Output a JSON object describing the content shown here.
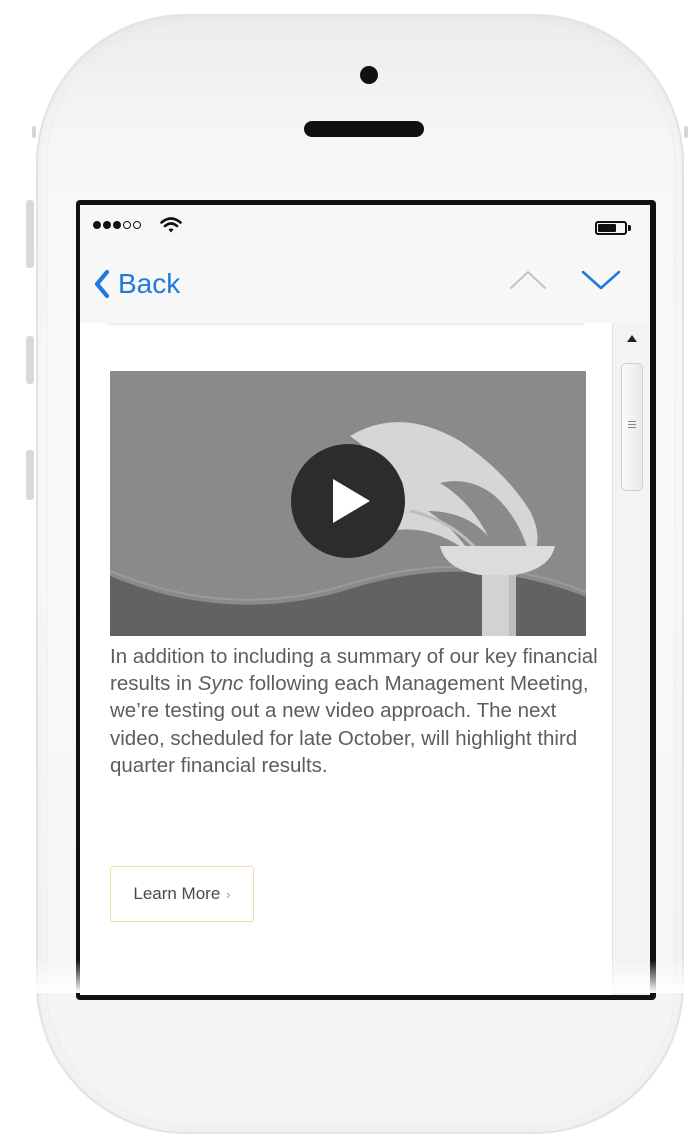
{
  "status_bar": {
    "signal_bars_filled": 3,
    "signal_bars_total": 5,
    "battery_level": 0.7
  },
  "nav": {
    "back_label": "Back"
  },
  "article": {
    "paragraph_before_italic": "In addition to including a summary of our key financial results in ",
    "paragraph_italic": "Sync",
    "paragraph_after_italic": " following each Management Meeting, we’re testing out a new video approach. The next video, scheduled for late October, will highlight third quarter financial results.",
    "learn_more_label": "Learn More",
    "learn_more_chevron": "›"
  },
  "icons": [
    "back-chevron-icon",
    "up-arrow-icon",
    "down-arrow-icon",
    "play-icon",
    "wifi-icon",
    "battery-icon",
    "scroll-up-icon"
  ],
  "colors": {
    "accent": "#1f7ae0",
    "button_border": "#f1dcae",
    "body_text": "#5d5d5d"
  }
}
